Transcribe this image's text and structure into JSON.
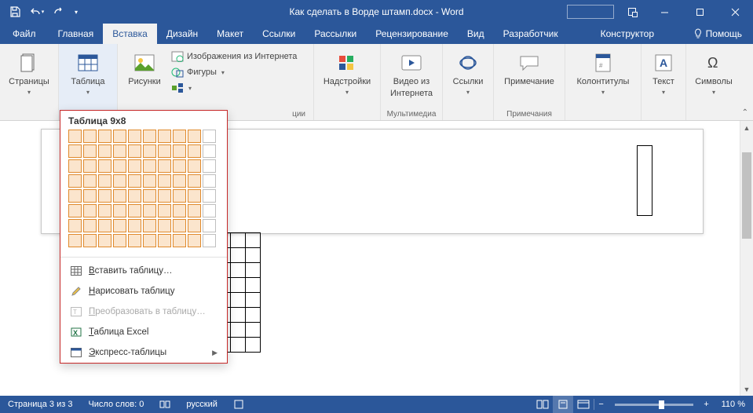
{
  "title": "Как сделать в Ворде штамп.docx - Word",
  "qat": {
    "save": "Сохранить",
    "undo": "Отменить",
    "redo": "Повторить"
  },
  "tabs": {
    "file": "Файл",
    "home": "Главная",
    "insert": "Вставка",
    "design": "Дизайн",
    "layout": "Макет",
    "references": "Ссылки",
    "mailings": "Рассылки",
    "review": "Рецензирование",
    "view": "Вид",
    "developer": "Разработчик",
    "constructor": "Конструктор",
    "help": "Помощь"
  },
  "ribbon": {
    "pages": {
      "label": "Страницы"
    },
    "table": {
      "label": "Таблица"
    },
    "pictures": "Рисунки",
    "online_pictures": "Изображения из Интернета",
    "shapes": "Фигуры",
    "addins": {
      "label": "Надстройки"
    },
    "online_video": {
      "line1": "Видео из",
      "line2": "Интернета",
      "group": "Мультимедиа"
    },
    "links": "Ссылки",
    "comment": {
      "label": "Примечание",
      "group": "Примечания"
    },
    "header_footer": "Колонтитулы",
    "text": "Текст",
    "symbols": "Символы",
    "illustrations_suffix": "ции"
  },
  "dropdown": {
    "title": "Таблица 9x8",
    "grid": {
      "cols": 10,
      "rows": 8,
      "sel_cols": 9,
      "sel_rows": 8
    },
    "items": {
      "insert": "ставить таблицу…",
      "insert_pre": "В",
      "draw": "арисовать таблицу",
      "draw_pre": "Н",
      "convert": "реобразовать в таблицу…",
      "convert_pre": "П",
      "excel": "аблица Excel",
      "excel_pre": "Т",
      "quick": "кспресс-таблицы",
      "quick_pre": "Э"
    }
  },
  "doc": {
    "table_rows": 8,
    "table_cols": 9
  },
  "status": {
    "page": "Страница 3 из 3",
    "words": "Число слов: 0",
    "lang": "русский",
    "zoom": "110 %"
  }
}
